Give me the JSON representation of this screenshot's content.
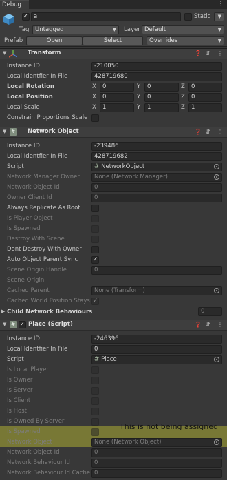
{
  "window": {
    "tab_title": "Debug"
  },
  "header": {
    "enabled": true,
    "name": "a",
    "static_label": "Static",
    "tag_label": "Tag",
    "tag_value": "Untagged",
    "layer_label": "Layer",
    "layer_value": "Default",
    "prefab_label": "Prefab",
    "open_label": "Open",
    "select_label": "Select",
    "overrides_label": "Overrides"
  },
  "transform": {
    "title": "Transform",
    "instance_id_label": "Instance ID",
    "instance_id": "-210050",
    "local_identifier_label": "Local Identfier In File",
    "local_identifier": "428719680",
    "rotation_label": "Local Rotation",
    "rotation": {
      "x": "0",
      "y": "0",
      "z": "0"
    },
    "position_label": "Local Position",
    "position": {
      "x": "0",
      "y": "0",
      "z": "0"
    },
    "scale_label": "Local Scale",
    "scale": {
      "x": "1",
      "y": "1",
      "z": "1"
    },
    "constrain_label": "Constrain Proportions Scale",
    "axis_x": "X",
    "axis_y": "Y",
    "axis_z": "Z"
  },
  "network_object": {
    "title": "Network Object",
    "rows": [
      {
        "label": "Instance ID",
        "value": "-239486",
        "dim": false
      },
      {
        "label": "Local Identfier In File",
        "value": "428719682",
        "dim": false
      },
      {
        "label": "Script",
        "value": "NetworkObject",
        "dim": false
      },
      {
        "label": "Network Manager Owner",
        "value": "None (Network Manager)",
        "dim": true
      },
      {
        "label": "Network Object Id",
        "value": "0",
        "dim": true
      },
      {
        "label": "Owner Client Id",
        "value": "0",
        "dim": true
      },
      {
        "label": "Always Replicate As Root",
        "value": "",
        "dim": false
      },
      {
        "label": "Is Player Object",
        "value": "",
        "dim": true
      },
      {
        "label": "Is Spawned",
        "value": "",
        "dim": true
      },
      {
        "label": "Destroy With Scene",
        "value": "",
        "dim": true
      },
      {
        "label": "Dont Destroy With Owner",
        "value": "",
        "dim": false
      },
      {
        "label": "Auto Object Parent Sync",
        "value": "",
        "dim": false
      },
      {
        "label": "Scene Origin Handle",
        "value": "0",
        "dim": true
      },
      {
        "label": "Scene Origin",
        "value": "",
        "dim": true
      },
      {
        "label": "Cached Parent",
        "value": "None (Transform)",
        "dim": true
      },
      {
        "label": "Cached World Position Stays",
        "value": "",
        "dim": true
      }
    ],
    "child_label": "Child Network Behaviours",
    "child_count": "0"
  },
  "place": {
    "title": "Place (Script)",
    "rows": [
      {
        "label": "Instance ID",
        "value": "-246396",
        "dim": false
      },
      {
        "label": "Local Identfier In File",
        "value": "0",
        "dim": false
      },
      {
        "label": "Script",
        "value": "Place",
        "dim": false
      },
      {
        "label": "Is Local Player",
        "value": "",
        "dim": true
      },
      {
        "label": "Is Owner",
        "value": "",
        "dim": true
      },
      {
        "label": "Is Server",
        "value": "",
        "dim": true
      },
      {
        "label": "Is Client",
        "value": "",
        "dim": true
      },
      {
        "label": "Is Host",
        "value": "",
        "dim": true
      },
      {
        "label": "Is Owned By Server",
        "value": "",
        "dim": true
      },
      {
        "label": "Is Spawned",
        "value": "",
        "dim": true
      },
      {
        "label": "Network Object",
        "value": "None (Network Object)",
        "dim": true
      },
      {
        "label": "Network Object Id",
        "value": "0",
        "dim": true
      },
      {
        "label": "Network Behaviour Id",
        "value": "0",
        "dim": true
      },
      {
        "label": "Network Behaviour Id Cache",
        "value": "0",
        "dim": true
      }
    ]
  },
  "annotation": {
    "text": "This is not being assigned",
    "highlight_color": "#d2d232"
  }
}
